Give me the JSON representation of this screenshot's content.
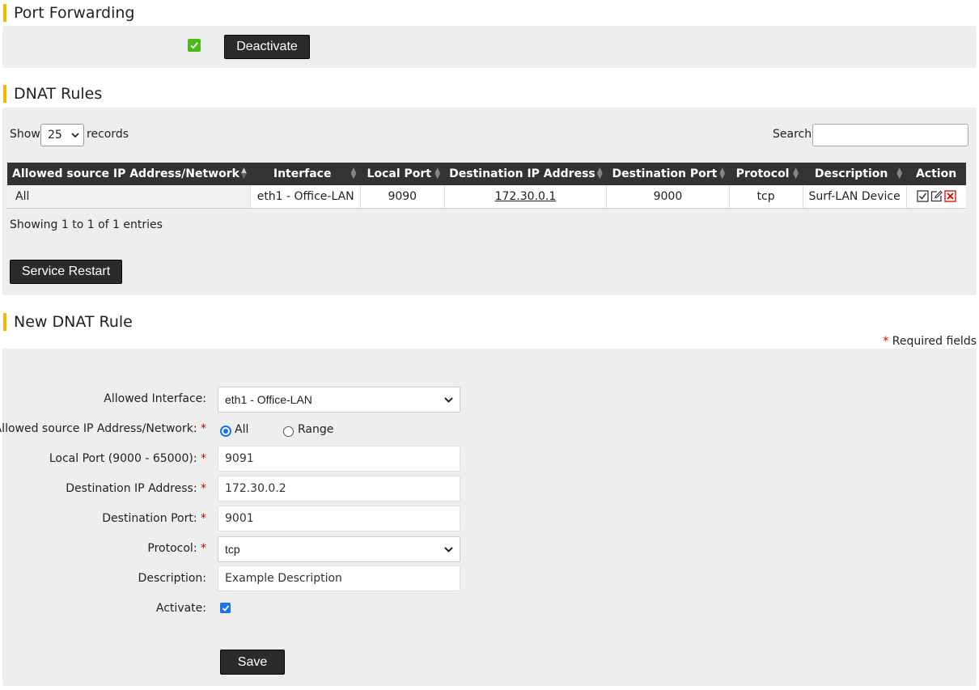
{
  "port_forwarding": {
    "title": "Port Forwarding",
    "status_checked": true,
    "deactivate_label": "Deactivate"
  },
  "dnat_rules": {
    "title": "DNAT Rules",
    "show_label": "Show",
    "page_size": "25",
    "records_label": "records",
    "search_label": "Search:",
    "search_value": "",
    "columns": [
      "Allowed source IP Address/Network",
      "Interface",
      "Local Port",
      "Destination IP Address",
      "Destination Port",
      "Protocol",
      "Description",
      "Action"
    ],
    "rows": [
      {
        "source": "All",
        "interface": "eth1 - Office-LAN",
        "local_port": "9090",
        "dest_ip": "172.30.0.1",
        "dest_port": "9000",
        "protocol": "tcp",
        "description": "Surf-LAN Device"
      }
    ],
    "info": "Showing 1 to 1 of 1 entries",
    "restart_label": "Service Restart"
  },
  "new_rule": {
    "title": "New DNAT Rule",
    "required_note": "Required fields",
    "required_star": "*",
    "interface_label": "Allowed Interface:",
    "interface_value": "eth1 - Office-LAN",
    "source_label": "Allowed source IP Address/Network:",
    "source_all": "All",
    "source_range": "Range",
    "source_selected": "All",
    "local_port_label": "Local Port (9000 - 65000):",
    "local_port_value": "9091",
    "dest_ip_label": "Destination IP Address:",
    "dest_ip_value": "172.30.0.2",
    "dest_port_label": "Destination Port:",
    "dest_port_value": "9001",
    "protocol_label": "Protocol:",
    "protocol_value": "tcp",
    "description_label": "Description:",
    "description_value": "Example Description",
    "activate_label": "Activate:",
    "activate_checked": true,
    "save_label": "Save"
  },
  "icons": {
    "status": "check-square-icon",
    "activate_action": "checkbox-icon",
    "edit_action": "edit-icon",
    "delete_action": "delete-icon",
    "dropdown": "chevron-down-icon"
  },
  "colors": {
    "accent": "#f5b800",
    "button_bg": "#2b2b2b",
    "panel_bg": "#eeeeee",
    "table_header": "#333333",
    "status_green": "#4cbb17",
    "required_red": "#cc0000",
    "delete_red": "#dd0000",
    "checkbox_blue": "#1a73e8"
  }
}
